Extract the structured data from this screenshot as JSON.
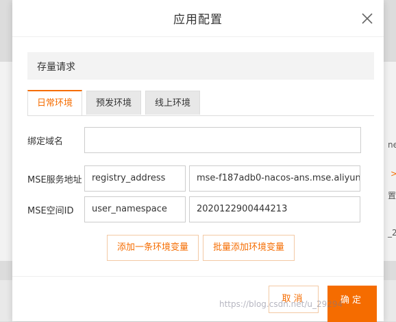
{
  "modal": {
    "title": "应用配置"
  },
  "section": {
    "label": "存量请求"
  },
  "tabs": [
    {
      "label": "日常环境",
      "active": true
    },
    {
      "label": "预发环境",
      "active": false
    },
    {
      "label": "线上环境",
      "active": false
    }
  ],
  "form": {
    "domain_label": "绑定域名",
    "domain_value": "",
    "mse_service_label": "MSE服务地址",
    "mse_service_key": "registry_address",
    "mse_service_value": "mse-f187adb0-nacos-ans.mse.aliyun",
    "mse_ns_label": "MSE空间ID",
    "mse_ns_key": "user_namespace",
    "mse_ns_value": "2020122900444213"
  },
  "actions": {
    "add_one": "添加一条环境变量",
    "add_batch": "批量添加环境变量"
  },
  "footer": {
    "cancel": "取消",
    "ok": "确定"
  },
  "background": {
    "right_text_1": "ne",
    "right_text_2": ">",
    "right_text_3": "置",
    "right_text_4": "_2"
  },
  "watermark": "https://blog.csdn.net/u_29294",
  "colors": {
    "accent": "#f56c00",
    "accent_border": "#f3c9a4"
  }
}
